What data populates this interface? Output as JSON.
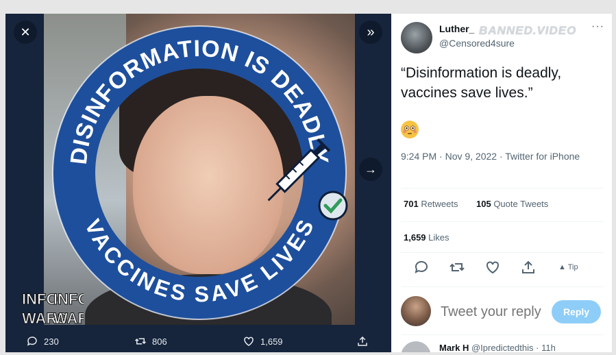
{
  "media": {
    "ring_top_text": "DISINFORMATION IS DEADLY",
    "ring_bottom_text": "VACCINES SAVE LIVES",
    "watermark_line1": "INFO",
    "watermark_line2": "WARS",
    "close_icon": "close-icon",
    "expand_icon": "double-chevron-right-icon",
    "next_icon": "arrow-right-icon",
    "ring_color": "#1e4f9c"
  },
  "media_actions": {
    "replies": "230",
    "retweets": "806",
    "likes": "1,659"
  },
  "tweet": {
    "user_name": "Luther_",
    "overlay_watermark": "BANNED.VIDEO",
    "handle": "@Censored4sure",
    "more": "···",
    "text": "“Disinformation is deadly, vaccines save lives.”",
    "emoji": "flushed-face-emoji",
    "timestamp": "9:24 PM · Nov 9, 2022 · Twitter for iPhone",
    "retweets_count": "701",
    "retweets_label": " Retweets",
    "quotes_count": "105",
    "quotes_label": " Quote Tweets",
    "likes_count": "1,659",
    "likes_label": " Likes",
    "tip_label": "Tip"
  },
  "reply": {
    "placeholder": "Tweet your reply",
    "button_label": "Reply",
    "next_reply_author": "Mark H",
    "next_reply_handle": "@Ipredictedthis",
    "next_reply_time": "· 11h"
  }
}
